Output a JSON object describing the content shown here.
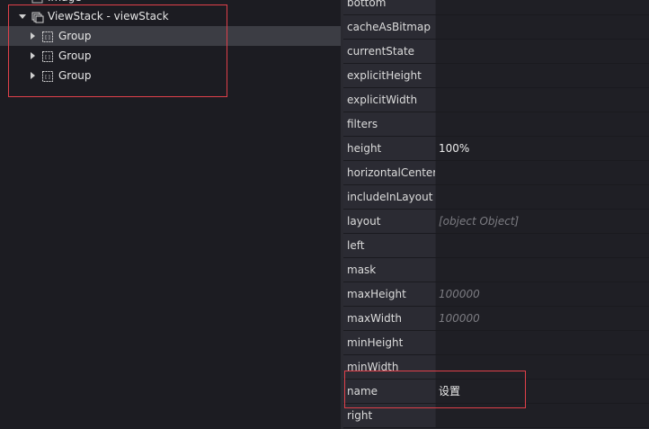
{
  "tree": {
    "partial_item": {
      "label": "Image"
    },
    "root": {
      "label": "ViewStack - viewStack",
      "expanded": true
    },
    "children": [
      {
        "label": "Group",
        "selected": true
      },
      {
        "label": "Group",
        "selected": false
      },
      {
        "label": "Group",
        "selected": false
      }
    ]
  },
  "properties": {
    "rows": [
      {
        "name": "bottom",
        "value": "",
        "placeholder": false
      },
      {
        "name": "cacheAsBitmap",
        "value": "",
        "placeholder": false
      },
      {
        "name": "currentState",
        "value": "",
        "placeholder": false
      },
      {
        "name": "explicitHeight",
        "value": "",
        "placeholder": false
      },
      {
        "name": "explicitWidth",
        "value": "",
        "placeholder": false
      },
      {
        "name": "filters",
        "value": "",
        "placeholder": false
      },
      {
        "name": "height",
        "value": "100%",
        "placeholder": false
      },
      {
        "name": "horizontalCenter",
        "value": "",
        "placeholder": false
      },
      {
        "name": "includeInLayout",
        "value": "",
        "placeholder": false
      },
      {
        "name": "layout",
        "value": "[object Object]",
        "placeholder": true
      },
      {
        "name": "left",
        "value": "",
        "placeholder": false
      },
      {
        "name": "mask",
        "value": "",
        "placeholder": false
      },
      {
        "name": "maxHeight",
        "value": "100000",
        "placeholder": true
      },
      {
        "name": "maxWidth",
        "value": "100000",
        "placeholder": true
      },
      {
        "name": "minHeight",
        "value": "",
        "placeholder": false
      },
      {
        "name": "minWidth",
        "value": "",
        "placeholder": false
      },
      {
        "name": "name",
        "value": "设置",
        "placeholder": false
      },
      {
        "name": "right",
        "value": "",
        "placeholder": false
      }
    ]
  },
  "colors": {
    "highlight": "#e0404a",
    "selected_row": "#3c3d44",
    "panel_bg": "#1c1c22"
  }
}
